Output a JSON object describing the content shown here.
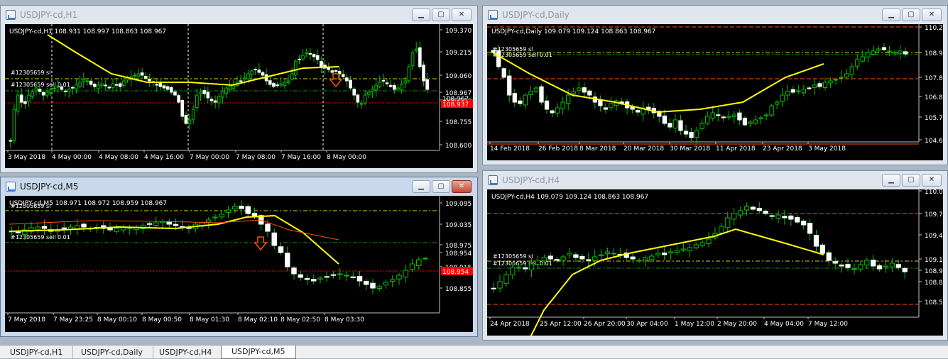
{
  "tabs": [
    {
      "label": "USDJPY-cd,H1",
      "active": false
    },
    {
      "label": "USDJPY-cd,Daily",
      "active": false
    },
    {
      "label": "USDJPY-cd,H4",
      "active": false
    },
    {
      "label": "USDJPY-cd,M5",
      "active": true
    }
  ],
  "windows": [
    {
      "title": "USDJPY-cd,H1",
      "active": false,
      "info": "USDJPY-cd,H1  108.931 108.997 108.863 108.967",
      "prices": [
        "109.370",
        "109.215",
        "109.060",
        "108.967",
        "108.910",
        "108.755",
        "108.600"
      ],
      "dates": [
        "3 May 2018",
        "4 May 00:00",
        "4 May 08:00",
        "4 May 16:00",
        "7 May 00:00",
        "7 May 08:00",
        "7 May 16:00",
        "8 May 00:00"
      ],
      "order_labels": [
        "#12305659 sl",
        "#12305659 sell 0.01"
      ],
      "bid_label": "108.937",
      "ask_label": "108.967"
    },
    {
      "title": "USDJPY-cd,Daily",
      "active": false,
      "info": "USDJPY-cd,Daily  109.079 109.124 108.863 108.967",
      "prices": [
        "110.2",
        "108.96",
        "107.8",
        "106.8",
        "105.7",
        "104.6"
      ],
      "dates": [
        "14 Feb 2018",
        "26 Feb 2018",
        "8 Mar 2018",
        "20 Mar 2018",
        "30 Mar 2018",
        "11 Apr 2018",
        "23 Apr 2018",
        "3 May 2018"
      ],
      "order_labels": [
        "#12305659 sl",
        "#12305659 sell 0.01"
      ]
    },
    {
      "title": "USDJPY-cd,M5",
      "active": true,
      "info": "USDJPY-cd,M5  108.971 108.972 108.959 108.967",
      "prices": [
        "109.095",
        "109.035",
        "108.975",
        "108.954",
        "108.915",
        "108.855"
      ],
      "dates": [
        "7 May 2018",
        "7 May 23:25",
        "8 May 00:10",
        "8 May 00:50",
        "8 May 01:30",
        "8 May 02:10",
        "8 May 02:50",
        "8 May 03:30"
      ],
      "order_labels": [
        "#12305659 sl",
        "#12305659 sell 0.01"
      ],
      "bid_label": "108.954"
    },
    {
      "title": "USDJPY-cd,H4",
      "active": false,
      "info": "USDJPY-cd,H4  109.079 109.124 108.863 108.967",
      "prices": [
        "110.0",
        "109.7",
        "109.4",
        "109.15",
        "108.9",
        "108.8",
        "108.5"
      ],
      "dates": [
        "24 Apr 2018",
        "25 Apr 12:00",
        "26 Apr 20:00",
        "30 Apr 04:00",
        "1 May 12:00",
        "2 May 20:00",
        "4 May 04:00",
        "7 May 12:00"
      ],
      "order_labels": [
        "#12305659 sl",
        "#12305659 sell 0.01"
      ]
    }
  ],
  "colors": {
    "bull": "#00c000",
    "bear": "#ffffff",
    "ma_fast": "#ffff00",
    "ma_slow": "#ff5000",
    "sl_line": "#d4d400",
    "order_line": "#00a000",
    "bid_line": "#ff0000",
    "hline": "#ff5000"
  }
}
